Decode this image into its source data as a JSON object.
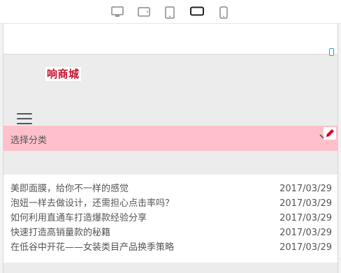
{
  "device_toolbar": {
    "devices": [
      "desktop-icon",
      "tablet-landscape-icon",
      "tablet-portrait-icon",
      "phone-landscape-icon",
      "phone-portrait-icon"
    ],
    "active": "phone-landscape-icon"
  },
  "site": {
    "logo_text": "响商城",
    "logo_color": "#c8102e"
  },
  "category": {
    "label": "选择分类",
    "bar_color": "#ffc0cb"
  },
  "articles": [
    {
      "title": "美即面膜，给你不一样的感觉",
      "date": "2017/03/29"
    },
    {
      "title": "泡妞一样去做设计，还需担心点击率吗？",
      "date": "2017/03/29"
    },
    {
      "title": "如何利用直通车打造爆款经验分享",
      "date": "2017/03/29"
    },
    {
      "title": "快速打造高销量款的秘籍",
      "date": "2017/03/29"
    },
    {
      "title": "在低谷中开花——女装类目产品换季策略",
      "date": "2017/03/29"
    }
  ],
  "colors": {
    "accent_blue": "#1a9fe0",
    "edit_red": "#e0001b"
  }
}
